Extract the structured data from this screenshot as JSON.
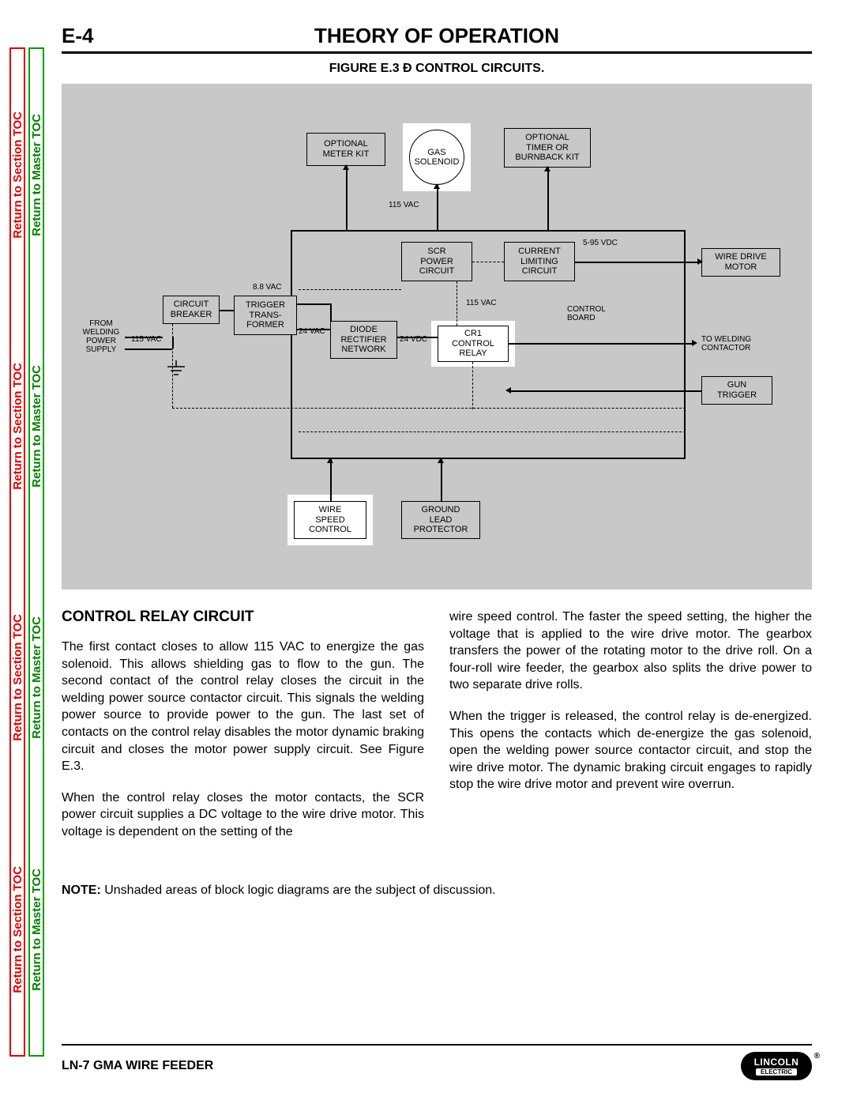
{
  "side": {
    "section": "Return to Section TOC",
    "master": "Return to Master TOC"
  },
  "header": {
    "page_num": "E-4",
    "title": "THEORY OF OPERATION"
  },
  "figure": {
    "caption": "FIGURE E.3 Ð CONTROL CIRCUITS.",
    "blocks": {
      "optional_meter": "OPTIONAL\nMETER KIT",
      "gas_solenoid": "GAS\nSOLENOID",
      "optional_timer": "OPTIONAL\nTIMER OR\nBURNBACK KIT",
      "scr": "SCR\nPOWER\nCIRCUIT",
      "current_limit": "CURRENT\nLIMITING\nCIRCUIT",
      "wire_drive": "WIRE DRIVE\nMOTOR",
      "circuit_breaker": "CIRCUIT\nBREAKER",
      "trigger_trans": "TRIGGER\nTRANS-\nFORMER",
      "diode_rect": "DIODE\nRECTIFIER\nNETWORK",
      "cr1": "CR1\nCONTROL\nRELAY",
      "gun_trigger": "GUN\nTRIGGER",
      "wire_speed": "WIRE\nSPEED\nCONTROL",
      "ground_lead": "GROUND\nLEAD\nPROTECTOR"
    },
    "labels": {
      "115vac_top": "115 VAC",
      "5_95vdc": "5-95 VDC",
      "8_8vac": "8.8 VAC",
      "115vac_mid": "115 VAC",
      "control_board": "CONTROL\nBOARD",
      "from_supply": "FROM\nWELDING\nPOWER\nSUPPLY",
      "115vac_left": "115 VAC",
      "24vac": "24 VAC",
      "24vdc": "24 VDC",
      "to_contactor": "TO WELDING\nCONTACTOR"
    }
  },
  "section": {
    "title": "CONTROL RELAY CIRCUIT",
    "col1_p1": "The first contact closes to allow 115 VAC to energize the gas solenoid. This allows shielding gas to flow to the gun. The second contact of the control relay closes the circuit in the welding power source contactor circuit. This signals the welding power source to provide power to the gun. The last set of contacts on the control relay disables the motor dynamic braking circuit and closes the motor power supply circuit. See Figure E.3.",
    "col1_p2": "When the control relay closes the motor contacts, the SCR power circuit supplies a DC voltage to the wire drive motor. This voltage is dependent on the setting of the",
    "col2_p1": "wire speed control. The faster the speed setting, the higher the voltage that is applied to the wire drive motor. The gearbox transfers the power of the rotating motor to the drive roll. On a four-roll wire feeder, the gearbox also splits the drive power to two separate drive rolls.",
    "col2_p2": "When the trigger is released, the control relay is de-energized. This opens the contacts which de-energize the gas solenoid, open the welding power source contactor circuit, and stop the wire drive motor. The dynamic braking circuit engages to rapidly stop the wire drive motor and prevent wire overrun."
  },
  "note": {
    "label": "NOTE:",
    "text": " Unshaded areas of block logic diagrams are the subject of discussion."
  },
  "footer": {
    "product": "LN-7 GMA WIRE FEEDER",
    "logo_top": "LINCOLN",
    "logo_bot": "ELECTRIC"
  }
}
